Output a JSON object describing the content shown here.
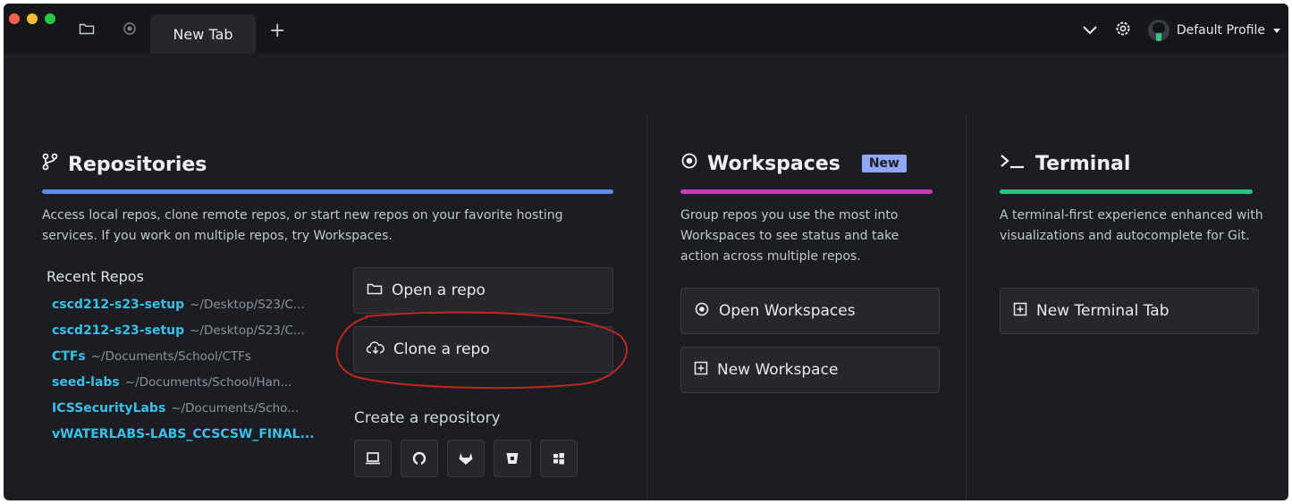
{
  "titlebar": {
    "tab_label": "New Tab",
    "new_tab_symbol": "+",
    "profile_name": "Default Profile",
    "icons": [
      "folder-icon",
      "workspace-icon",
      "chevron-down-icon",
      "gear-icon",
      "caret-down-icon"
    ]
  },
  "repositories": {
    "title": "Repositories",
    "description": "Access local repos, clone remote repos, or start new repos on your favorite hosting services. If you work on multiple repos, try Workspaces.",
    "recent_title": "Recent Repos",
    "recent": [
      {
        "name": "cscd212-s23-setup",
        "path": "~/Desktop/S23/C..."
      },
      {
        "name": "cscd212-s23-setup",
        "path": "~/Desktop/S23/C..."
      },
      {
        "name": "CTFs",
        "path": "~/Documents/School/CTFs"
      },
      {
        "name": "seed-labs",
        "path": "~/Documents/School/Han..."
      },
      {
        "name": "ICSSecurityLabs",
        "path": "~/Documents/Scho..."
      },
      {
        "name": "vWATERLABS-LABS_CCSCSW_FINAL...",
        "path": ""
      }
    ],
    "open_label": "Open a repo",
    "clone_label": "Clone a repo",
    "create_title": "Create a repository",
    "host_icons": [
      "laptop-icon",
      "github-icon",
      "gitlab-icon",
      "bitbucket-icon",
      "azure-devops-icon"
    ],
    "accent_color": "#5b8def"
  },
  "workspaces": {
    "title": "Workspaces",
    "badge": "New",
    "description": "Group repos you use the most into Workspaces to see status and take action across multiple repos.",
    "open_label": "Open Workspaces",
    "new_label": "New Workspace",
    "accent_color": "#c23cc0"
  },
  "terminal": {
    "title": "Terminal",
    "description": "A terminal-first experience enhanced with visualizations and autocomplete for Git.",
    "new_tab_label": "New Terminal Tab",
    "accent_color": "#2ec27e"
  },
  "colors": {
    "background": "#1b1d22",
    "link": "#3ac0e8",
    "annotation": "#c0261c"
  }
}
